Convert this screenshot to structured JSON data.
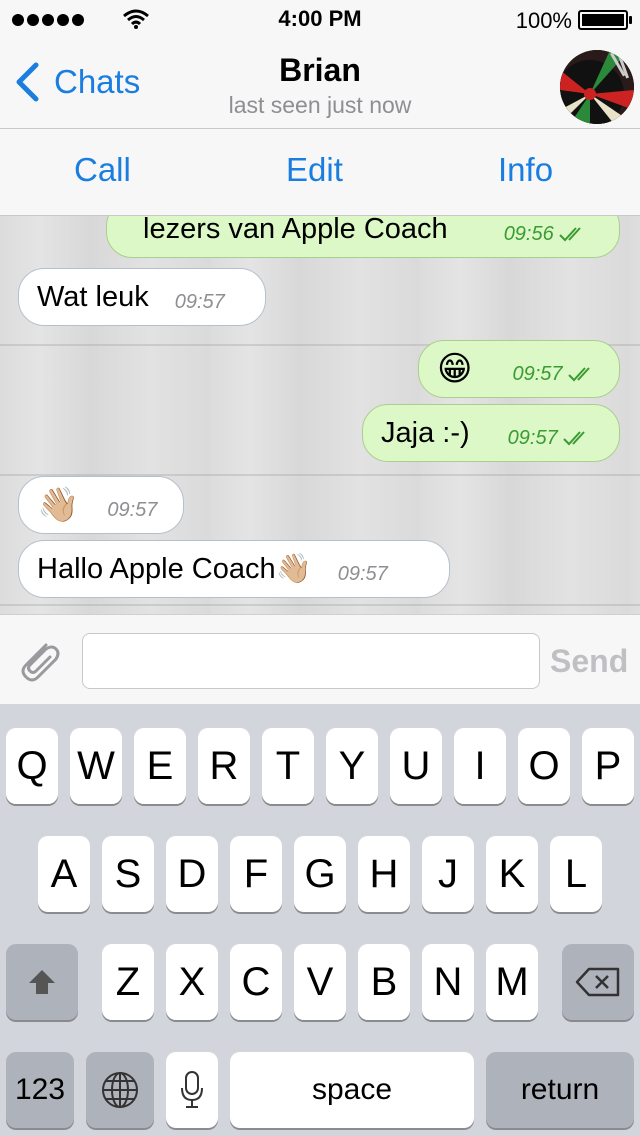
{
  "status_bar": {
    "time": "4:00 PM",
    "battery": "100%",
    "icons": [
      "signal-dots",
      "apple-icon",
      "wifi-icon",
      "battery-icon"
    ]
  },
  "nav": {
    "back_label": "Chats",
    "title": "Brian",
    "subtitle": "last seen just now"
  },
  "actions": {
    "call": "Call",
    "edit": "Edit",
    "info": "Info"
  },
  "messages": [
    {
      "direction": "out",
      "text": "lezers van Apple Coach",
      "time": "09:56"
    },
    {
      "direction": "in",
      "text": "Wat leuk",
      "time": "09:57"
    },
    {
      "direction": "out",
      "text": "😁",
      "time": "09:57"
    },
    {
      "direction": "out",
      "text": "Jaja :-)",
      "time": "09:57"
    },
    {
      "direction": "in",
      "text": "👋🏼",
      "time": "09:57"
    },
    {
      "direction": "in",
      "text": "Hallo Apple Coach👋🏼",
      "time": "09:57"
    }
  ],
  "input": {
    "placeholder": "",
    "send_label": "Send"
  },
  "keyboard": {
    "row1": [
      "Q",
      "W",
      "E",
      "R",
      "T",
      "Y",
      "U",
      "I",
      "O",
      "P"
    ],
    "row2": [
      "A",
      "S",
      "D",
      "F",
      "G",
      "H",
      "J",
      "K",
      "L"
    ],
    "row3": [
      "Z",
      "X",
      "C",
      "V",
      "B",
      "N",
      "M"
    ],
    "numbers_label": "123",
    "space_label": "space",
    "return_label": "return"
  },
  "colors": {
    "accent": "#1a7de0",
    "outgoing_bubble": "#dcf8c6",
    "incoming_bubble": "#ffffff",
    "read_ticks": "#3a9b33"
  }
}
